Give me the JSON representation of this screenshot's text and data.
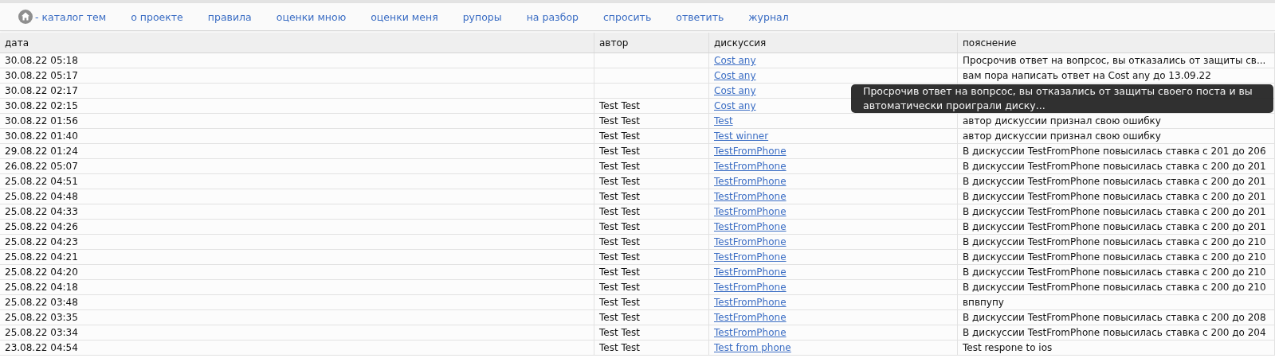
{
  "nav": [
    {
      "label": "- каталог тем",
      "kind": "home"
    },
    {
      "label": "о проекте",
      "kind": "link"
    },
    {
      "label": "правила",
      "kind": "link"
    },
    {
      "label": "оценки мною",
      "kind": "link"
    },
    {
      "label": "оценки меня",
      "kind": "link"
    },
    {
      "label": "рупоры",
      "kind": "link"
    },
    {
      "label": "на разбор",
      "kind": "link"
    },
    {
      "label": "спросить",
      "kind": "link"
    },
    {
      "label": "ответить",
      "kind": "link"
    },
    {
      "label": "журнал",
      "kind": "link"
    }
  ],
  "table": {
    "columns": [
      "дата",
      "автор",
      "дискуссия",
      "пояснение"
    ],
    "rows": [
      {
        "date": "30.08.22 05:18",
        "author": "",
        "discussion": "Cost any",
        "note": "Просрочив ответ на вопрсос, вы отказались от защиты св..."
      },
      {
        "date": "30.08.22 05:17",
        "author": "",
        "discussion": "Cost any",
        "note": "вам пора написать ответ на Cost any до 13.09.22"
      },
      {
        "date": "30.08.22 02:17",
        "author": "",
        "discussion": "Cost any",
        "note": ""
      },
      {
        "date": "30.08.22 02:15",
        "author": "Test Test",
        "discussion": "Cost any",
        "note": ""
      },
      {
        "date": "30.08.22 01:56",
        "author": "Test Test",
        "discussion": "Test",
        "note": "автор дискуссии признал свою ошибку"
      },
      {
        "date": "30.08.22 01:40",
        "author": "Test Test",
        "discussion": "Test winner",
        "note": "автор дискуссии признал свою ошибку"
      },
      {
        "date": "29.08.22 01:24",
        "author": "Test Test",
        "discussion": "TestFromPhone",
        "note": "В дискуссии TestFromPhone повысилась ставка с 201 до 206"
      },
      {
        "date": "26.08.22 05:07",
        "author": "Test Test",
        "discussion": "TestFromPhone",
        "note": "В дискуссии TestFromPhone повысилась ставка с 200 до 201"
      },
      {
        "date": "25.08.22 04:51",
        "author": "Test Test",
        "discussion": "TestFromPhone",
        "note": "В дискуссии TestFromPhone повысилась ставка с 200 до 201"
      },
      {
        "date": "25.08.22 04:48",
        "author": "Test Test",
        "discussion": "TestFromPhone",
        "note": "В дискуссии TestFromPhone повысилась ставка с 200 до 201"
      },
      {
        "date": "25.08.22 04:33",
        "author": "Test Test",
        "discussion": "TestFromPhone",
        "note": "В дискуссии TestFromPhone повысилась ставка с 200 до 201"
      },
      {
        "date": "25.08.22 04:26",
        "author": "Test Test",
        "discussion": "TestFromPhone",
        "note": "В дискуссии TestFromPhone повысилась ставка с 200 до 201"
      },
      {
        "date": "25.08.22 04:23",
        "author": "Test Test",
        "discussion": "TestFromPhone",
        "note": "В дискуссии TestFromPhone повысилась ставка с 200 до 210"
      },
      {
        "date": "25.08.22 04:21",
        "author": "Test Test",
        "discussion": "TestFromPhone",
        "note": "В дискуссии TestFromPhone повысилась ставка с 200 до 210"
      },
      {
        "date": "25.08.22 04:20",
        "author": "Test Test",
        "discussion": "TestFromPhone",
        "note": "В дискуссии TestFromPhone повысилась ставка с 200 до 210"
      },
      {
        "date": "25.08.22 04:18",
        "author": "Test Test",
        "discussion": "TestFromPhone",
        "note": "В дискуссии TestFromPhone повысилась ставка с 200 до 210"
      },
      {
        "date": "25.08.22 03:48",
        "author": "Test Test",
        "discussion": "TestFromPhone",
        "note": "впвпупу"
      },
      {
        "date": "25.08.22 03:35",
        "author": "Test Test",
        "discussion": "TestFromPhone",
        "note": "В дискуссии TestFromPhone повысилась ставка с 200 до 208"
      },
      {
        "date": "25.08.22 03:34",
        "author": "Test Test",
        "discussion": "TestFromPhone",
        "note": "В дискуссии TestFromPhone повысилась ставка с 200 до 204"
      },
      {
        "date": "23.08.22 04:54",
        "author": "Test Test",
        "discussion": "Test from phone",
        "note": "Test respone to ios"
      }
    ]
  },
  "tooltip": {
    "text": "Просрочив ответ на вопрсос, вы отказались от защиты своего поста и вы автоматически проиграли диску..."
  }
}
